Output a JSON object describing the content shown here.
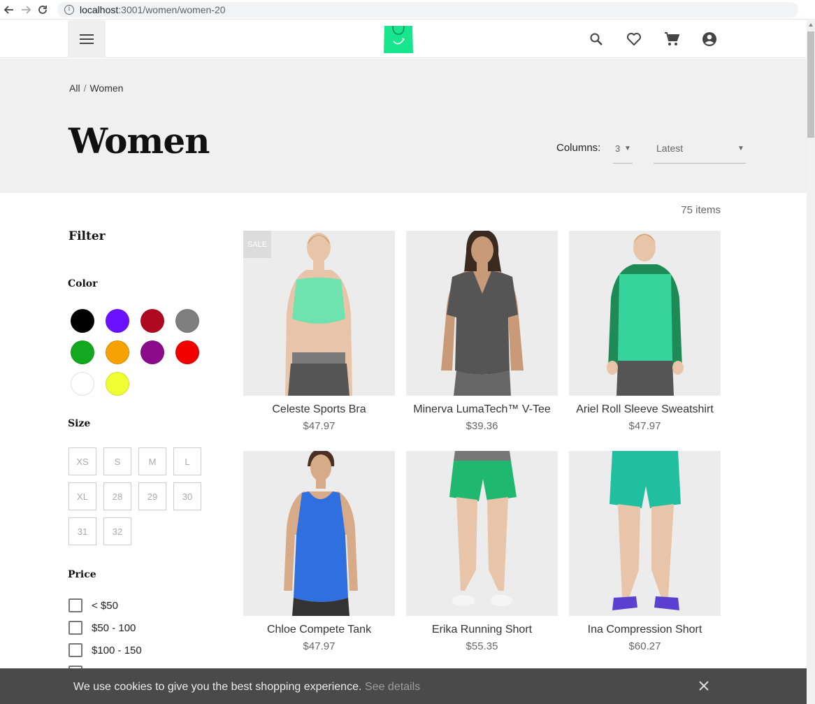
{
  "browser": {
    "url_host": "localhost",
    "url_path": ":3001/women/women-20"
  },
  "header": {
    "menu_icon": "menu-icon",
    "logo_icon": "shopping-bag-logo-icon",
    "icons": [
      "search-icon",
      "heart-icon",
      "cart-icon",
      "account-icon"
    ],
    "brand_color": "#17e68e"
  },
  "breadcrumb": {
    "items": [
      "All",
      "Women"
    ],
    "separator": "/"
  },
  "page_title": "Women",
  "toolbar": {
    "columns_label": "Columns:",
    "columns_value": "3",
    "sort_value": "Latest"
  },
  "item_count": "75 items",
  "filter": {
    "title": "Filter",
    "color_title": "Color",
    "colors": [
      "#000000",
      "#6b11ff",
      "#b0081e",
      "#7f7f7f",
      "#12a81f",
      "#f5a003",
      "#8c0a8c",
      "#f20000",
      "#ffffff",
      "#f0ff33"
    ],
    "size_title": "Size",
    "sizes": [
      "XS",
      "S",
      "M",
      "L",
      "XL",
      "28",
      "29",
      "30",
      "31",
      "32"
    ],
    "price_title": "Price",
    "prices": [
      "< $50",
      "$50 - 100",
      "$100 - 150"
    ]
  },
  "products": [
    {
      "name": "Celeste Sports Bra",
      "price": "$47.97",
      "badge": "SALE"
    },
    {
      "name": "Minerva LumaTech™ V-Tee",
      "price": "$39.36",
      "badge": ""
    },
    {
      "name": "Ariel Roll Sleeve Sweatshirt",
      "price": "$47.97",
      "badge": ""
    },
    {
      "name": "Chloe Compete Tank",
      "price": "$47.97",
      "badge": ""
    },
    {
      "name": "Erika Running Short",
      "price": "$55.35",
      "badge": ""
    },
    {
      "name": "Ina Compression Short",
      "price": "$60.27",
      "badge": ""
    }
  ],
  "cookie": {
    "text": "We use cookies to give you the best shopping experience.",
    "link": "See details",
    "close_icon": "close-icon"
  }
}
